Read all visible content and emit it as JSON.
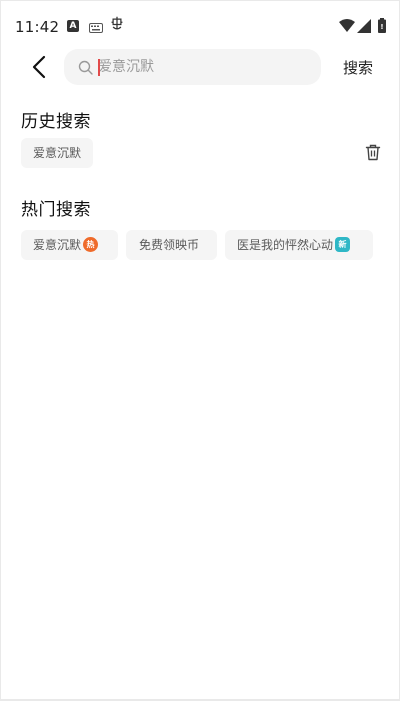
{
  "status_bar": {
    "time": "11:42"
  },
  "search": {
    "placeholder": "爱意沉默",
    "submit_label": "搜索"
  },
  "history": {
    "title": "历史搜索",
    "items": [
      "爱意沉默"
    ]
  },
  "hot": {
    "title": "热门搜索",
    "items": [
      {
        "label": "爱意沉默",
        "badge": "hot"
      },
      {
        "label": "免费领映币",
        "badge": ""
      },
      {
        "label": "医是我的怦然心动",
        "badge": "new"
      }
    ]
  },
  "colors": {
    "hot_badge": "#ef6b2b",
    "new_badge": "#2fb7c6",
    "caret": "#e24a4a"
  },
  "icons": {
    "back": "chevron-left-icon",
    "search": "magnifier-icon",
    "delete": "trash-icon"
  }
}
